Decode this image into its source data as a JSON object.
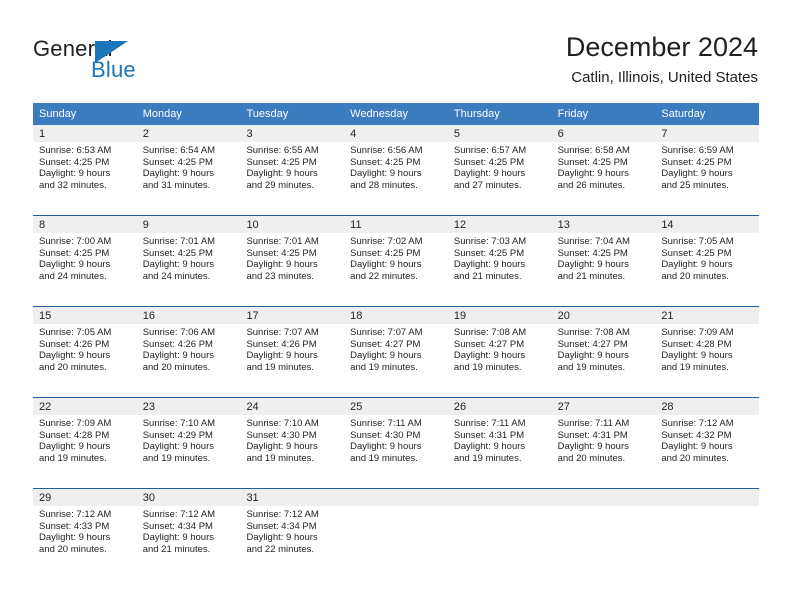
{
  "brand": {
    "name_top": "General",
    "name_bottom": "Blue",
    "accent_color": "#1b75bb",
    "text_color": "#231f20"
  },
  "header": {
    "title": "December 2024",
    "location": "Catlin, Illinois, United States"
  },
  "theme": {
    "header_blue": "#3b7cbf",
    "rule_blue": "#1f5fa0",
    "band_gray": "#efefef"
  },
  "weekdays": [
    "Sunday",
    "Monday",
    "Tuesday",
    "Wednesday",
    "Thursday",
    "Friday",
    "Saturday"
  ],
  "weeks": [
    [
      {
        "day": "1",
        "sunrise": "Sunrise: 6:53 AM",
        "sunset": "Sunset: 4:25 PM",
        "daylight_line1": "Daylight: 9 hours",
        "daylight_line2": "and 32 minutes."
      },
      {
        "day": "2",
        "sunrise": "Sunrise: 6:54 AM",
        "sunset": "Sunset: 4:25 PM",
        "daylight_line1": "Daylight: 9 hours",
        "daylight_line2": "and 31 minutes."
      },
      {
        "day": "3",
        "sunrise": "Sunrise: 6:55 AM",
        "sunset": "Sunset: 4:25 PM",
        "daylight_line1": "Daylight: 9 hours",
        "daylight_line2": "and 29 minutes."
      },
      {
        "day": "4",
        "sunrise": "Sunrise: 6:56 AM",
        "sunset": "Sunset: 4:25 PM",
        "daylight_line1": "Daylight: 9 hours",
        "daylight_line2": "and 28 minutes."
      },
      {
        "day": "5",
        "sunrise": "Sunrise: 6:57 AM",
        "sunset": "Sunset: 4:25 PM",
        "daylight_line1": "Daylight: 9 hours",
        "daylight_line2": "and 27 minutes."
      },
      {
        "day": "6",
        "sunrise": "Sunrise: 6:58 AM",
        "sunset": "Sunset: 4:25 PM",
        "daylight_line1": "Daylight: 9 hours",
        "daylight_line2": "and 26 minutes."
      },
      {
        "day": "7",
        "sunrise": "Sunrise: 6:59 AM",
        "sunset": "Sunset: 4:25 PM",
        "daylight_line1": "Daylight: 9 hours",
        "daylight_line2": "and 25 minutes."
      }
    ],
    [
      {
        "day": "8",
        "sunrise": "Sunrise: 7:00 AM",
        "sunset": "Sunset: 4:25 PM",
        "daylight_line1": "Daylight: 9 hours",
        "daylight_line2": "and 24 minutes."
      },
      {
        "day": "9",
        "sunrise": "Sunrise: 7:01 AM",
        "sunset": "Sunset: 4:25 PM",
        "daylight_line1": "Daylight: 9 hours",
        "daylight_line2": "and 24 minutes."
      },
      {
        "day": "10",
        "sunrise": "Sunrise: 7:01 AM",
        "sunset": "Sunset: 4:25 PM",
        "daylight_line1": "Daylight: 9 hours",
        "daylight_line2": "and 23 minutes."
      },
      {
        "day": "11",
        "sunrise": "Sunrise: 7:02 AM",
        "sunset": "Sunset: 4:25 PM",
        "daylight_line1": "Daylight: 9 hours",
        "daylight_line2": "and 22 minutes."
      },
      {
        "day": "12",
        "sunrise": "Sunrise: 7:03 AM",
        "sunset": "Sunset: 4:25 PM",
        "daylight_line1": "Daylight: 9 hours",
        "daylight_line2": "and 21 minutes."
      },
      {
        "day": "13",
        "sunrise": "Sunrise: 7:04 AM",
        "sunset": "Sunset: 4:25 PM",
        "daylight_line1": "Daylight: 9 hours",
        "daylight_line2": "and 21 minutes."
      },
      {
        "day": "14",
        "sunrise": "Sunrise: 7:05 AM",
        "sunset": "Sunset: 4:25 PM",
        "daylight_line1": "Daylight: 9 hours",
        "daylight_line2": "and 20 minutes."
      }
    ],
    [
      {
        "day": "15",
        "sunrise": "Sunrise: 7:05 AM",
        "sunset": "Sunset: 4:26 PM",
        "daylight_line1": "Daylight: 9 hours",
        "daylight_line2": "and 20 minutes."
      },
      {
        "day": "16",
        "sunrise": "Sunrise: 7:06 AM",
        "sunset": "Sunset: 4:26 PM",
        "daylight_line1": "Daylight: 9 hours",
        "daylight_line2": "and 20 minutes."
      },
      {
        "day": "17",
        "sunrise": "Sunrise: 7:07 AM",
        "sunset": "Sunset: 4:26 PM",
        "daylight_line1": "Daylight: 9 hours",
        "daylight_line2": "and 19 minutes."
      },
      {
        "day": "18",
        "sunrise": "Sunrise: 7:07 AM",
        "sunset": "Sunset: 4:27 PM",
        "daylight_line1": "Daylight: 9 hours",
        "daylight_line2": "and 19 minutes."
      },
      {
        "day": "19",
        "sunrise": "Sunrise: 7:08 AM",
        "sunset": "Sunset: 4:27 PM",
        "daylight_line1": "Daylight: 9 hours",
        "daylight_line2": "and 19 minutes."
      },
      {
        "day": "20",
        "sunrise": "Sunrise: 7:08 AM",
        "sunset": "Sunset: 4:27 PM",
        "daylight_line1": "Daylight: 9 hours",
        "daylight_line2": "and 19 minutes."
      },
      {
        "day": "21",
        "sunrise": "Sunrise: 7:09 AM",
        "sunset": "Sunset: 4:28 PM",
        "daylight_line1": "Daylight: 9 hours",
        "daylight_line2": "and 19 minutes."
      }
    ],
    [
      {
        "day": "22",
        "sunrise": "Sunrise: 7:09 AM",
        "sunset": "Sunset: 4:28 PM",
        "daylight_line1": "Daylight: 9 hours",
        "daylight_line2": "and 19 minutes."
      },
      {
        "day": "23",
        "sunrise": "Sunrise: 7:10 AM",
        "sunset": "Sunset: 4:29 PM",
        "daylight_line1": "Daylight: 9 hours",
        "daylight_line2": "and 19 minutes."
      },
      {
        "day": "24",
        "sunrise": "Sunrise: 7:10 AM",
        "sunset": "Sunset: 4:30 PM",
        "daylight_line1": "Daylight: 9 hours",
        "daylight_line2": "and 19 minutes."
      },
      {
        "day": "25",
        "sunrise": "Sunrise: 7:11 AM",
        "sunset": "Sunset: 4:30 PM",
        "daylight_line1": "Daylight: 9 hours",
        "daylight_line2": "and 19 minutes."
      },
      {
        "day": "26",
        "sunrise": "Sunrise: 7:11 AM",
        "sunset": "Sunset: 4:31 PM",
        "daylight_line1": "Daylight: 9 hours",
        "daylight_line2": "and 19 minutes."
      },
      {
        "day": "27",
        "sunrise": "Sunrise: 7:11 AM",
        "sunset": "Sunset: 4:31 PM",
        "daylight_line1": "Daylight: 9 hours",
        "daylight_line2": "and 20 minutes."
      },
      {
        "day": "28",
        "sunrise": "Sunrise: 7:12 AM",
        "sunset": "Sunset: 4:32 PM",
        "daylight_line1": "Daylight: 9 hours",
        "daylight_line2": "and 20 minutes."
      }
    ],
    [
      {
        "day": "29",
        "sunrise": "Sunrise: 7:12 AM",
        "sunset": "Sunset: 4:33 PM",
        "daylight_line1": "Daylight: 9 hours",
        "daylight_line2": "and 20 minutes."
      },
      {
        "day": "30",
        "sunrise": "Sunrise: 7:12 AM",
        "sunset": "Sunset: 4:34 PM",
        "daylight_line1": "Daylight: 9 hours",
        "daylight_line2": "and 21 minutes."
      },
      {
        "day": "31",
        "sunrise": "Sunrise: 7:12 AM",
        "sunset": "Sunset: 4:34 PM",
        "daylight_line1": "Daylight: 9 hours",
        "daylight_line2": "and 22 minutes."
      },
      {
        "day": "",
        "sunrise": "",
        "sunset": "",
        "daylight_line1": "",
        "daylight_line2": ""
      },
      {
        "day": "",
        "sunrise": "",
        "sunset": "",
        "daylight_line1": "",
        "daylight_line2": ""
      },
      {
        "day": "",
        "sunrise": "",
        "sunset": "",
        "daylight_line1": "",
        "daylight_line2": ""
      },
      {
        "day": "",
        "sunrise": "",
        "sunset": "",
        "daylight_line1": "",
        "daylight_line2": ""
      }
    ]
  ]
}
